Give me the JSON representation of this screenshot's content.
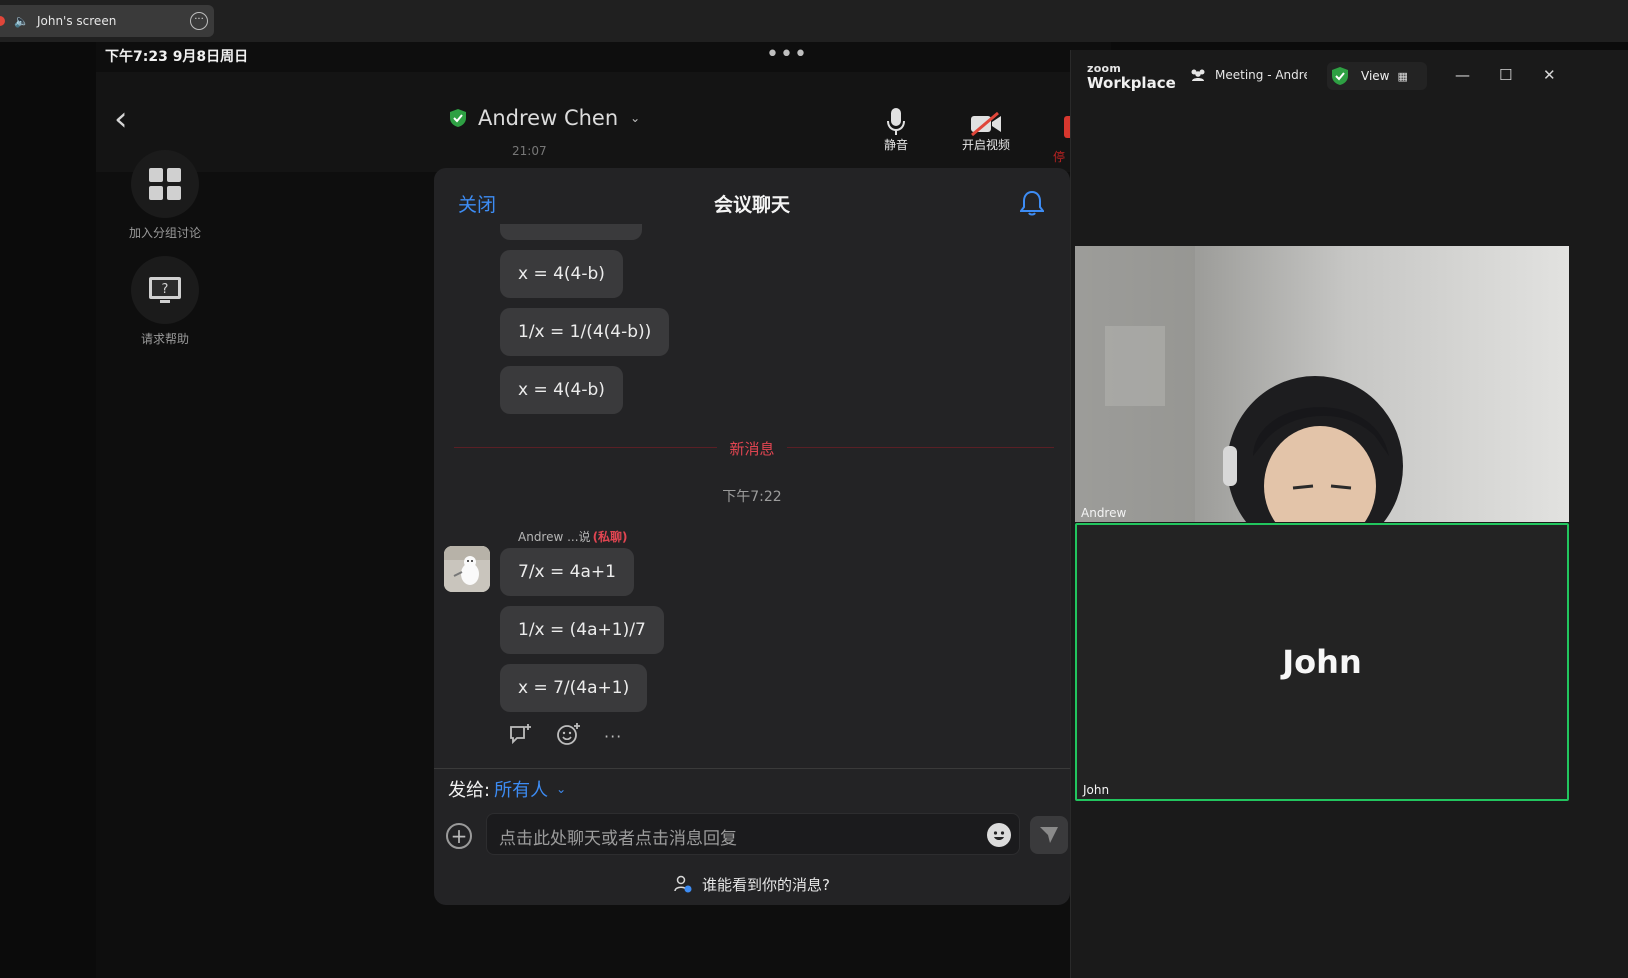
{
  "share_bar": {
    "label": "John's screen",
    "speaker_icon": "speaker-icon",
    "more_icon": "ellipsis-icon"
  },
  "ipad": {
    "status_time": "下午7:23   9月8日周日",
    "more_dots": "•••",
    "host": {
      "name": "Andrew Chen",
      "elapsed": "21:07",
      "shield_color": "#2ea043"
    },
    "tools": [
      {
        "label": "静音",
        "icon": "microphone-icon"
      },
      {
        "label": "开启视频",
        "icon": "video-off-icon"
      }
    ],
    "stop_partial": "停",
    "side_buttons": [
      {
        "label": "加入分组讨论",
        "icon": "breakout-rooms-icon"
      },
      {
        "label": "请求帮助",
        "icon": "help-icon"
      }
    ]
  },
  "chat": {
    "close_label": "关闭",
    "title": "会议聊天",
    "earlier_messages": [
      "x = 4(4-b)",
      "1/x = 1/(4(4-b))",
      "x = 4(4-b)"
    ],
    "new_messages_label": "新消息",
    "time_label": "下午7:22",
    "sender": "Andrew ...说",
    "private_tag": "(私聊)",
    "new_messages": [
      "7/x = 4a+1",
      "1/x = (4a+1)/7",
      "x = 7/(4a+1)"
    ],
    "send_to_label": "发给:",
    "send_to_value": "所有人",
    "input_placeholder": "点击此处聊天或者点击消息回复",
    "who_can_see": "谁能看到你的消息?",
    "accent_color": "#3d8cf4",
    "alert_color": "#e04551"
  },
  "zoom": {
    "brand_small": "zoom",
    "brand": "Workplace",
    "meeting_title": "Meeting - Andrew",
    "view_label": "View",
    "participants": [
      {
        "name": "Andrew"
      },
      {
        "name": "John",
        "display": "John",
        "highlight": "#22c55e"
      }
    ]
  }
}
